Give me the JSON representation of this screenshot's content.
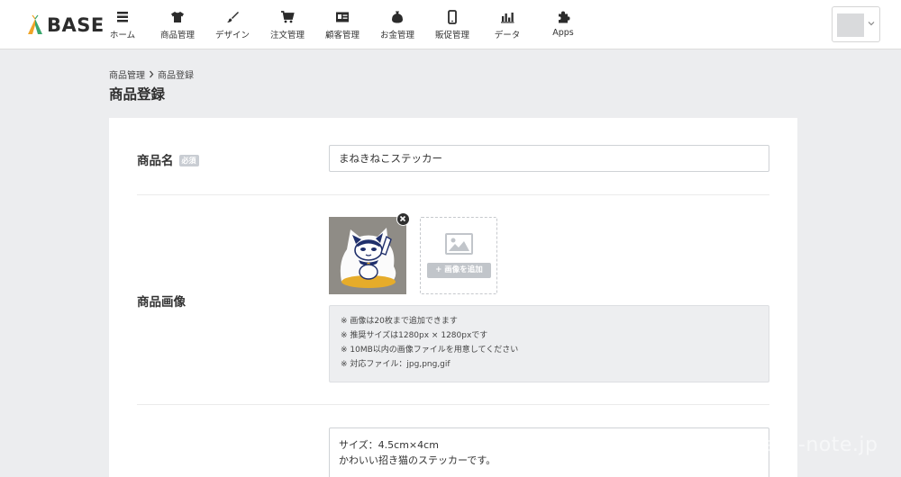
{
  "app": {
    "logo_text": "BASE"
  },
  "nav": [
    {
      "label": "ホーム",
      "icon": "list-icon"
    },
    {
      "label": "商品管理",
      "icon": "tshirt-icon"
    },
    {
      "label": "デザイン",
      "icon": "brush-icon"
    },
    {
      "label": "注文管理",
      "icon": "cart-icon"
    },
    {
      "label": "顧客管理",
      "icon": "id-card-icon"
    },
    {
      "label": "お金管理",
      "icon": "money-bag-icon"
    },
    {
      "label": "販促管理",
      "icon": "phone-icon"
    },
    {
      "label": "データ",
      "icon": "bar-chart-icon"
    },
    {
      "label": "Apps",
      "icon": "puzzle-icon"
    }
  ],
  "breadcrumb": {
    "parent": "商品管理",
    "current": "商品登録"
  },
  "page": {
    "title": "商品登録"
  },
  "form": {
    "name": {
      "label": "商品名",
      "required_badge": "必須",
      "value": "まねきねこステッカー"
    },
    "image": {
      "label": "商品画像",
      "add_button": "画像を追加",
      "notes": [
        "※ 画像は20枚まで追加できます",
        "※ 推奨サイズは1280px × 1280pxです",
        "※ 10MB以内の画像ファイルを用意してください",
        "※ 対応ファイル：jpg,png,gif"
      ]
    },
    "description": {
      "lines": [
        "サイズ：4.5cm×4cm",
        "かわいい招き猫のステッカーです。"
      ]
    }
  },
  "watermark": "m…a…-note.jp",
  "colors": {
    "accent_orange": "#f0a428",
    "accent_green": "#3aa76d",
    "background": "#ecedef"
  }
}
